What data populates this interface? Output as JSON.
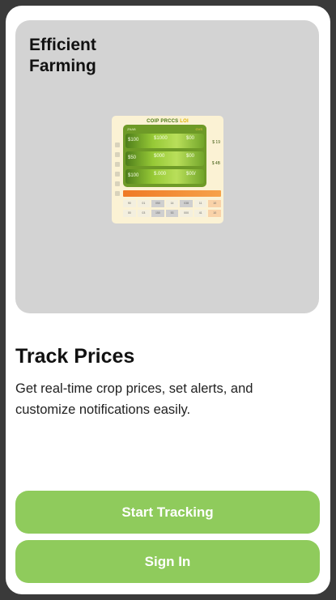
{
  "onboarding": {
    "hero_title": "Efficient Farming",
    "illustration": {
      "title_part1": "COIP PRCCS",
      "title_part2": "LOI",
      "header_left": "ZNAB",
      "header_right": "GVS",
      "rows": [
        {
          "c1": "$100",
          "c2": "$1000",
          "c3": "$00",
          "right": "$ 19"
        },
        {
          "c1": "$50",
          "c2": "$000",
          "c3": "$00",
          "right": "$ 4B"
        },
        {
          "c1": "$100",
          "c2": "$.000",
          "c3": "$00/",
          "right": ""
        }
      ],
      "grid": [
        [
          "90",
          "01",
          "050",
          "14",
          "038",
          "11",
          "10"
        ],
        [
          "00",
          "03",
          "150",
          "53",
          "000",
          "41",
          "10"
        ]
      ]
    },
    "heading": "Track Prices",
    "description": "Get real-time crop prices, set alerts, and customize notifications easily.",
    "primary_button": "Start Tracking",
    "secondary_button": "Sign In"
  },
  "colors": {
    "button_green": "#8fcb5c",
    "hero_gray": "#d3d3d3"
  }
}
